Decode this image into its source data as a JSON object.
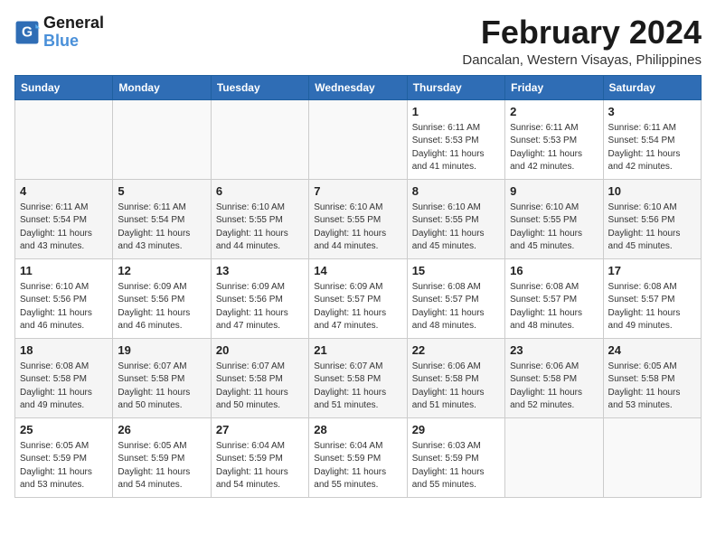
{
  "logo": {
    "text_general": "General",
    "text_blue": "Blue"
  },
  "title": {
    "month_year": "February 2024",
    "location": "Dancalan, Western Visayas, Philippines"
  },
  "days_of_week": [
    "Sunday",
    "Monday",
    "Tuesday",
    "Wednesday",
    "Thursday",
    "Friday",
    "Saturday"
  ],
  "weeks": [
    [
      {
        "day": "",
        "info": ""
      },
      {
        "day": "",
        "info": ""
      },
      {
        "day": "",
        "info": ""
      },
      {
        "day": "",
        "info": ""
      },
      {
        "day": "1",
        "info": "Sunrise: 6:11 AM\nSunset: 5:53 PM\nDaylight: 11 hours\nand 41 minutes."
      },
      {
        "day": "2",
        "info": "Sunrise: 6:11 AM\nSunset: 5:53 PM\nDaylight: 11 hours\nand 42 minutes."
      },
      {
        "day": "3",
        "info": "Sunrise: 6:11 AM\nSunset: 5:54 PM\nDaylight: 11 hours\nand 42 minutes."
      }
    ],
    [
      {
        "day": "4",
        "info": "Sunrise: 6:11 AM\nSunset: 5:54 PM\nDaylight: 11 hours\nand 43 minutes."
      },
      {
        "day": "5",
        "info": "Sunrise: 6:11 AM\nSunset: 5:54 PM\nDaylight: 11 hours\nand 43 minutes."
      },
      {
        "day": "6",
        "info": "Sunrise: 6:10 AM\nSunset: 5:55 PM\nDaylight: 11 hours\nand 44 minutes."
      },
      {
        "day": "7",
        "info": "Sunrise: 6:10 AM\nSunset: 5:55 PM\nDaylight: 11 hours\nand 44 minutes."
      },
      {
        "day": "8",
        "info": "Sunrise: 6:10 AM\nSunset: 5:55 PM\nDaylight: 11 hours\nand 45 minutes."
      },
      {
        "day": "9",
        "info": "Sunrise: 6:10 AM\nSunset: 5:55 PM\nDaylight: 11 hours\nand 45 minutes."
      },
      {
        "day": "10",
        "info": "Sunrise: 6:10 AM\nSunset: 5:56 PM\nDaylight: 11 hours\nand 45 minutes."
      }
    ],
    [
      {
        "day": "11",
        "info": "Sunrise: 6:10 AM\nSunset: 5:56 PM\nDaylight: 11 hours\nand 46 minutes."
      },
      {
        "day": "12",
        "info": "Sunrise: 6:09 AM\nSunset: 5:56 PM\nDaylight: 11 hours\nand 46 minutes."
      },
      {
        "day": "13",
        "info": "Sunrise: 6:09 AM\nSunset: 5:56 PM\nDaylight: 11 hours\nand 47 minutes."
      },
      {
        "day": "14",
        "info": "Sunrise: 6:09 AM\nSunset: 5:57 PM\nDaylight: 11 hours\nand 47 minutes."
      },
      {
        "day": "15",
        "info": "Sunrise: 6:08 AM\nSunset: 5:57 PM\nDaylight: 11 hours\nand 48 minutes."
      },
      {
        "day": "16",
        "info": "Sunrise: 6:08 AM\nSunset: 5:57 PM\nDaylight: 11 hours\nand 48 minutes."
      },
      {
        "day": "17",
        "info": "Sunrise: 6:08 AM\nSunset: 5:57 PM\nDaylight: 11 hours\nand 49 minutes."
      }
    ],
    [
      {
        "day": "18",
        "info": "Sunrise: 6:08 AM\nSunset: 5:58 PM\nDaylight: 11 hours\nand 49 minutes."
      },
      {
        "day": "19",
        "info": "Sunrise: 6:07 AM\nSunset: 5:58 PM\nDaylight: 11 hours\nand 50 minutes."
      },
      {
        "day": "20",
        "info": "Sunrise: 6:07 AM\nSunset: 5:58 PM\nDaylight: 11 hours\nand 50 minutes."
      },
      {
        "day": "21",
        "info": "Sunrise: 6:07 AM\nSunset: 5:58 PM\nDaylight: 11 hours\nand 51 minutes."
      },
      {
        "day": "22",
        "info": "Sunrise: 6:06 AM\nSunset: 5:58 PM\nDaylight: 11 hours\nand 51 minutes."
      },
      {
        "day": "23",
        "info": "Sunrise: 6:06 AM\nSunset: 5:58 PM\nDaylight: 11 hours\nand 52 minutes."
      },
      {
        "day": "24",
        "info": "Sunrise: 6:05 AM\nSunset: 5:58 PM\nDaylight: 11 hours\nand 53 minutes."
      }
    ],
    [
      {
        "day": "25",
        "info": "Sunrise: 6:05 AM\nSunset: 5:59 PM\nDaylight: 11 hours\nand 53 minutes."
      },
      {
        "day": "26",
        "info": "Sunrise: 6:05 AM\nSunset: 5:59 PM\nDaylight: 11 hours\nand 54 minutes."
      },
      {
        "day": "27",
        "info": "Sunrise: 6:04 AM\nSunset: 5:59 PM\nDaylight: 11 hours\nand 54 minutes."
      },
      {
        "day": "28",
        "info": "Sunrise: 6:04 AM\nSunset: 5:59 PM\nDaylight: 11 hours\nand 55 minutes."
      },
      {
        "day": "29",
        "info": "Sunrise: 6:03 AM\nSunset: 5:59 PM\nDaylight: 11 hours\nand 55 minutes."
      },
      {
        "day": "",
        "info": ""
      },
      {
        "day": "",
        "info": ""
      }
    ]
  ]
}
